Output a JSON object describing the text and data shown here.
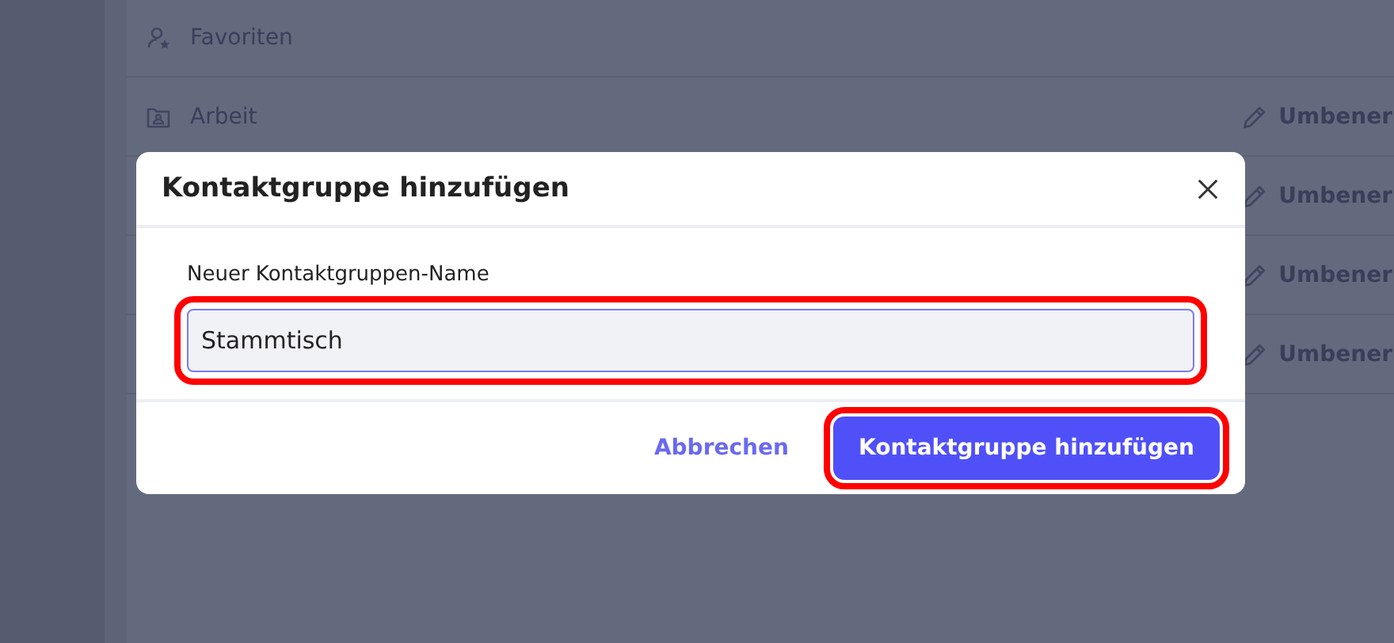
{
  "groups": [
    {
      "label": "Favoriten",
      "kind": "favorites"
    },
    {
      "label": "Arbeit",
      "kind": "folder",
      "action": "Umbener"
    },
    {
      "action": "Umbener"
    },
    {
      "action": "Umbener"
    },
    {
      "action": "Umbener"
    }
  ],
  "dialog": {
    "title": "Kontaktgruppe hinzufügen",
    "field_label": "Neuer Kontaktgruppen-Name",
    "field_value": "Stammtisch",
    "field_highlighted": true,
    "buttons": [
      {
        "label": "Abbrechen",
        "kind": "link"
      },
      {
        "label": "Kontaktgruppe hinzufügen",
        "kind": "primary",
        "highlighted": true
      }
    ]
  }
}
